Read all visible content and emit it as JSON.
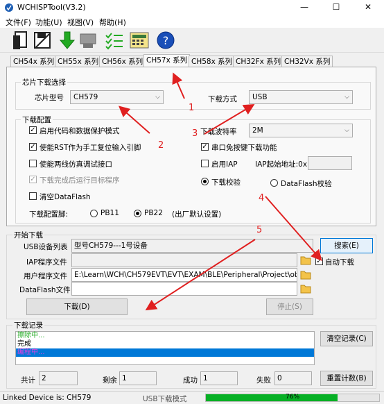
{
  "window": {
    "title": "WCHISPTool(V3.2)",
    "minimize": "—",
    "maximize": "☐",
    "close": "✕"
  },
  "menu": {
    "file": "文件(F)",
    "function": "功能(U)",
    "view": "视图(V)",
    "help": "帮助(H)"
  },
  "toolbar": [
    "open-file-icon",
    "save-file-icon",
    "download-arrow-icon",
    "device-icon",
    "checklist-icon",
    "calculator-icon",
    "help-icon"
  ],
  "tabs": [
    "CH54x 系列",
    "CH55x 系列",
    "CH56x 系列",
    "CH57x 系列",
    "CH58x 系列",
    "CH32Fx 系列",
    "CH32Vx 系列"
  ],
  "chip_select": {
    "group_label": "芯片下载选择",
    "model_label": "芯片型号",
    "model_value": "CH579",
    "mode_label": "下载方式",
    "mode_value": "USB"
  },
  "config": {
    "group_label": "下载配置",
    "opt_protect": "启用代码和数据保护模式",
    "opt_rst": "使能RST作为手工复位输入引脚",
    "opt_twowire": "使能两线仿真调试接口",
    "opt_run": "下载完成后运行目标程序",
    "opt_clear": "清空DataFlash",
    "baud_label": "下载波特率",
    "baud_value": "2M",
    "opt_serial": "串口免按键下载功能",
    "opt_iap": "启用IAP",
    "iap_addr_label": "IAP起始地址:0x",
    "verify": "下载校验",
    "verify_df": "DataFlash校验",
    "pin_label": "下载配置脚:",
    "pb11": "PB11",
    "pb22": "PB22",
    "pin_note": "(出厂默认设置)"
  },
  "download": {
    "group_label": "开始下载",
    "usb_label": "USB设备列表",
    "usb_value": "型号CH579---1号设备",
    "search": "搜索(E)",
    "iap_label": "IAP程序文件",
    "auto": "自动下载",
    "user_label": "用户程序文件",
    "user_value": "E:\\Learn\\WCH\\CH579EVT\\EVT\\EXAM\\BLE\\Peripheral\\Project\\obj\\BLE.h",
    "df_label": "DataFlash文件",
    "download_btn": "下载(D)",
    "stop_btn": "停止(S)"
  },
  "log": {
    "group_label": "下载记录",
    "lines": [
      "擦除中...",
      "完成",
      "编程中..."
    ],
    "clear": "清空记录(C)"
  },
  "counts": {
    "total_label": "共计",
    "total": "2",
    "remain_label": "剩余",
    "remain": "1",
    "success_label": "成功",
    "success": "1",
    "fail_label": "失败",
    "fail": "0",
    "reset": "重置计数(B)"
  },
  "status": {
    "device": "Linked Device is: CH579",
    "mode": "USB下载模式",
    "progress": "76%",
    "progress_value": 0.76
  },
  "annotations": [
    "1",
    "2",
    "3",
    "4",
    "5"
  ]
}
